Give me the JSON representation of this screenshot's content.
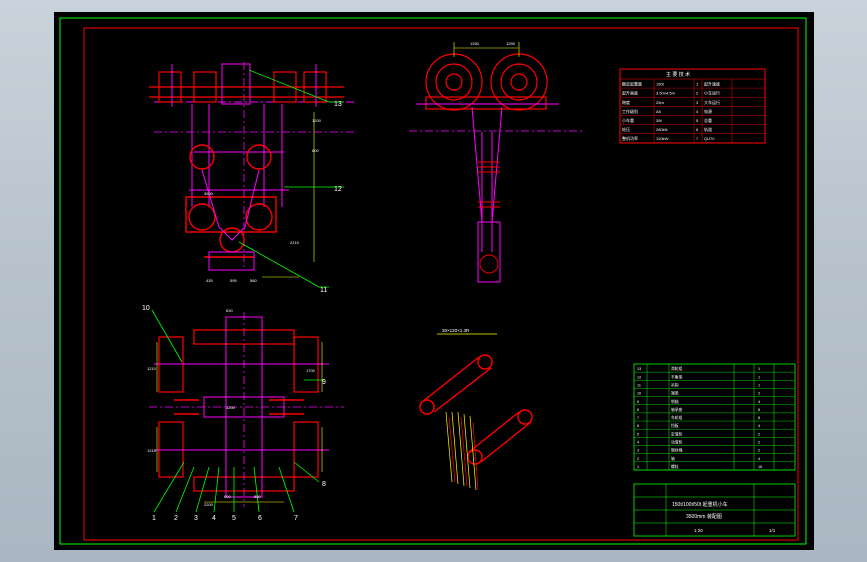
{
  "drawing": {
    "sheet_colors": {
      "background": "#000000",
      "outer_frame": "#00ff00",
      "inner_frame": "#ff0000",
      "geometry_red": "#ff0000",
      "geometry_magenta": "#ff00ff",
      "leader_green": "#00ff00",
      "text_white": "#ffffff",
      "dim_yellow": "#ffff00",
      "window_bg": "#c5cfd8"
    },
    "view_top": {
      "balloons": [
        "13",
        "12",
        "11"
      ],
      "dims": [
        "1200",
        "800",
        "3600",
        "2210",
        "435",
        "595",
        "580"
      ]
    },
    "view_side": {
      "dims": [
        "1250",
        "1250"
      ]
    },
    "view_plan": {
      "balloons": [
        "10",
        "9",
        "8",
        "1",
        "2",
        "3",
        "4",
        "5",
        "6",
        "7"
      ],
      "dims": [
        "1210",
        "630",
        "3200",
        "1700",
        "1210",
        "2200",
        "600",
        "800"
      ]
    },
    "view_detail": {
      "title": "30×120×1.3R"
    },
    "spec_table": {
      "title": "主 要 技 术",
      "rows": [
        [
          "额定起重量",
          "150t",
          "1",
          "起升速度"
        ],
        [
          "起升高度",
          "3.5m/4.5m",
          "2",
          "小车运行"
        ],
        [
          "跨度",
          "25m",
          "3",
          "大车运行"
        ],
        [
          "工作级别",
          "A5",
          "4",
          "电源"
        ],
        [
          "小车重",
          "35t",
          "5",
          "总重"
        ],
        [
          "轮压",
          "280kN",
          "6",
          "轨道"
        ],
        [
          "整机功率",
          "120kW",
          "7",
          "QU70"
        ]
      ]
    },
    "parts_table": {
      "rows": [
        [
          "13",
          "滑轮组",
          "1",
          ""
        ],
        [
          "12",
          "平衡梁",
          "1",
          ""
        ],
        [
          "11",
          "吊钩",
          "1",
          ""
        ],
        [
          "10",
          "端梁",
          "2",
          ""
        ],
        [
          "9",
          "销轴",
          "4",
          ""
        ],
        [
          "8",
          "轴承座",
          "8",
          ""
        ],
        [
          "7",
          "车轮组",
          "8",
          ""
        ],
        [
          "6",
          "挡板",
          "4",
          ""
        ],
        [
          "5",
          "定滑轮",
          "2",
          ""
        ],
        [
          "4",
          "动滑轮",
          "2",
          ""
        ],
        [
          "3",
          "钢丝绳",
          "2",
          ""
        ],
        [
          "2",
          "轴",
          "4",
          ""
        ],
        [
          "1",
          "螺栓",
          "16",
          ""
        ]
      ]
    },
    "title_block": {
      "title": "150t/100t/50t 起重机小车",
      "subtitle": "3500mm 装配图",
      "scale": "1:20",
      "sheet": "1/1"
    }
  }
}
